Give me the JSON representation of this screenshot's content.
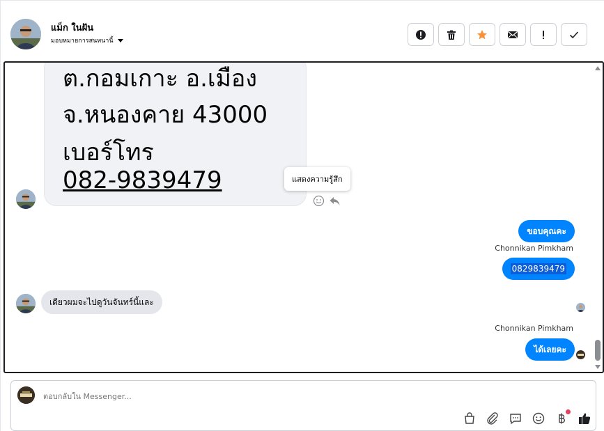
{
  "header": {
    "contact_name": "แม็ก ในฝัน",
    "assign_label": "มอบหมายการสนทนานี้",
    "toolbar": [
      {
        "name": "spam-button",
        "icon": "alert-circle-icon",
        "color": "#1c1e21"
      },
      {
        "name": "delete-button",
        "icon": "trash-icon",
        "color": "#1c1e21"
      },
      {
        "name": "star-button",
        "icon": "star-icon",
        "color": "#f7923b"
      },
      {
        "name": "unread-button",
        "icon": "envelope-icon",
        "color": "#1c1e21"
      },
      {
        "name": "follow-up-button",
        "icon": "exclamation-icon",
        "color": "#1c1e21"
      },
      {
        "name": "done-button",
        "icon": "check-icon",
        "color": "#1c1e21"
      }
    ]
  },
  "messages": {
    "address_lines": [
      "ต.กอมเกาะ อ.เมือง",
      "จ.หนองคาย 43000",
      "เบอร์โทร",
      "082-9839479"
    ],
    "tooltip": "แสดงความรู้สึก",
    "outgoing_1": "ขอบคุณคะ",
    "sender_1": "Chonnikan Pimkham",
    "outgoing_2": "0829839479",
    "incoming_1": "เดียวผมจะไปดูวันจันทร์นี้และ",
    "sender_2": "Chonnikan Pimkham",
    "outgoing_3": "ได้เลยคะ"
  },
  "composer": {
    "placeholder": "ตอบกลับใน Messenger..."
  },
  "colors": {
    "messenger_blue": "#0084ff",
    "incoming_bg": "#e4e6eb",
    "star_orange": "#f7923b",
    "notification_dot": "#e4405f"
  }
}
